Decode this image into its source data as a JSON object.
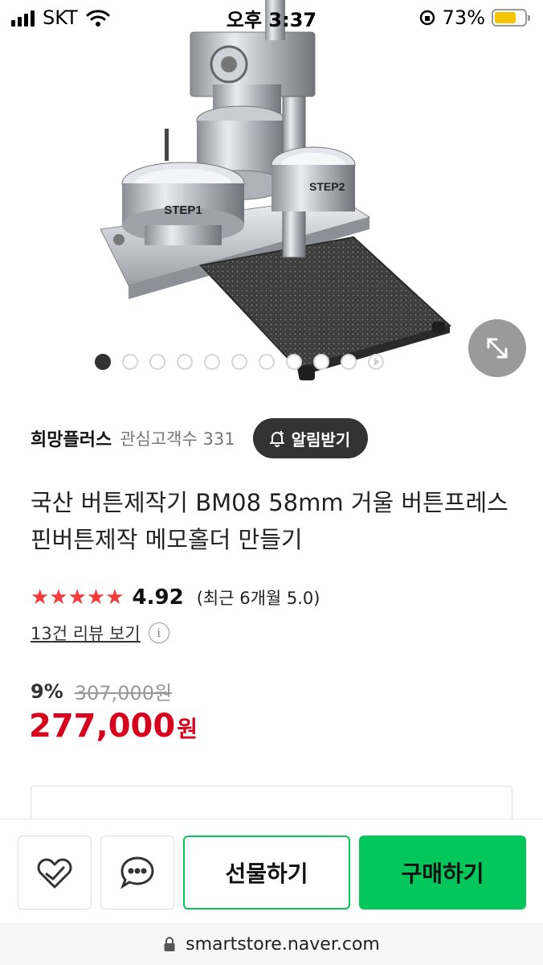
{
  "status_bar": {
    "carrier": "SKT",
    "time": "오후 3:37",
    "battery": "73%",
    "battery_level": 0.73
  },
  "gallery": {
    "slide_count": 10,
    "active_index": 0,
    "has_video": true,
    "expand_icon": "expand-arrows-icon",
    "image_text": [
      "STEP1",
      "STEP2"
    ]
  },
  "store": {
    "name": "희망플러스",
    "fans": "관심고객수 331",
    "alarm_label": "알림받기",
    "alarm_icon": "bell-plus-icon"
  },
  "product": {
    "title": "국산 버튼제작기 BM08 58mm 거울 버튼프레스 핀버튼제작 메모홀더 만들기"
  },
  "rating": {
    "stars": 5,
    "score": "4.92",
    "recent": "(최근 6개월 5.0)",
    "review_link": "13건 리뷰 보기",
    "info_icon": "i"
  },
  "price": {
    "discount": "9%",
    "original": "307,000원",
    "current": "277,000",
    "unit": "원"
  },
  "actions": {
    "zzim_icon": "heart-check-icon",
    "talk_icon": "chat-bubble-icon",
    "gift_label": "선물하기",
    "buy_label": "구매하기"
  },
  "browser": {
    "url": "smartstore.naver.com",
    "lock_icon": "lock-icon"
  },
  "colors": {
    "accent_green": "#03c75a",
    "price_red": "#d6001c",
    "star_red": "#f23a3a"
  }
}
